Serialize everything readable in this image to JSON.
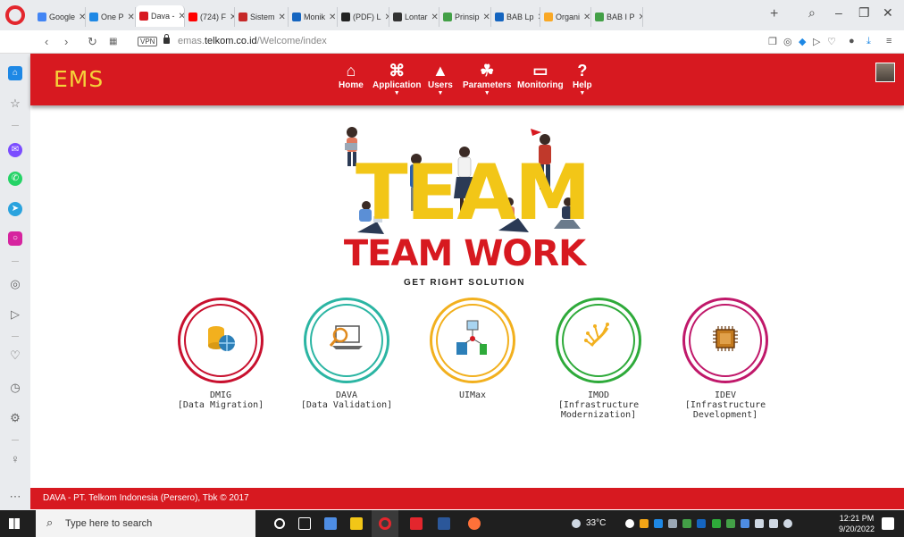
{
  "browser": {
    "tabs": [
      {
        "label": "Google",
        "color": "#4285f4"
      },
      {
        "label": "One P",
        "color": "#1e88e5"
      },
      {
        "label": "Dava -",
        "color": "#d71920",
        "active": true
      },
      {
        "label": "(724) F",
        "color": "#ff0000"
      },
      {
        "label": "Sistem",
        "color": "#c62828"
      },
      {
        "label": "Monik",
        "color": "#1565c0"
      },
      {
        "label": "(PDF) L",
        "color": "#222222"
      },
      {
        "label": "Lontar",
        "color": "#333333"
      },
      {
        "label": "Prinsip",
        "color": "#43a047"
      },
      {
        "label": "BAB Lp",
        "color": "#1565c0"
      },
      {
        "label": "Organi",
        "color": "#f9a825"
      },
      {
        "label": "BAB I P",
        "color": "#43a047"
      }
    ],
    "url_prefix": "emas.",
    "url_domain": "telkom.co.id",
    "url_path": "/Welcome/index",
    "vpn_label": "VPN"
  },
  "app": {
    "logo": "EMS",
    "menu": [
      {
        "label": "Home",
        "icon": "home-icon",
        "glyph": "⌂",
        "has_dropdown": false
      },
      {
        "label": "Application",
        "icon": "apps-icon",
        "glyph": "⌘",
        "has_dropdown": true
      },
      {
        "label": "Users",
        "icon": "user-icon",
        "glyph": "▲",
        "has_dropdown": true
      },
      {
        "label": "Parameters",
        "icon": "parameters-icon",
        "glyph": "☘",
        "has_dropdown": true
      },
      {
        "label": "Monitoring",
        "icon": "monitor-icon",
        "glyph": "▭",
        "has_dropdown": false
      },
      {
        "label": "Help",
        "icon": "help-icon",
        "glyph": "?",
        "has_dropdown": true
      }
    ],
    "hero": {
      "big_word": "TEAM",
      "title": "TEAM WORK",
      "tagline": "GET RIGHT SOLUTION"
    },
    "applications": [
      {
        "name": "DMIG",
        "subtitle": "[Data Migration]",
        "color": "#c8102e",
        "icon": "database-globe-icon"
      },
      {
        "name": "DAVA",
        "subtitle": "[Data Validation]",
        "color": "#2bb5a3",
        "icon": "laptop-search-icon"
      },
      {
        "name": "UIMax",
        "subtitle": "",
        "color": "#f2b01e",
        "icon": "network-devices-icon"
      },
      {
        "name": "IMOD",
        "subtitle": "[Infrastructure Modernization]",
        "color": "#2eaa3a",
        "icon": "circuit-hand-icon"
      },
      {
        "name": "IDEV",
        "subtitle": "[Infrastructure Development]",
        "color": "#c0186a",
        "icon": "chip-icon"
      }
    ],
    "footer": "DAVA - PT. Telkom Indonesia (Persero), Tbk © 2017"
  },
  "taskbar": {
    "search_placeholder": "Type here to search",
    "weather": "33°C",
    "time": "12:21 PM",
    "date": "9/20/2022"
  }
}
